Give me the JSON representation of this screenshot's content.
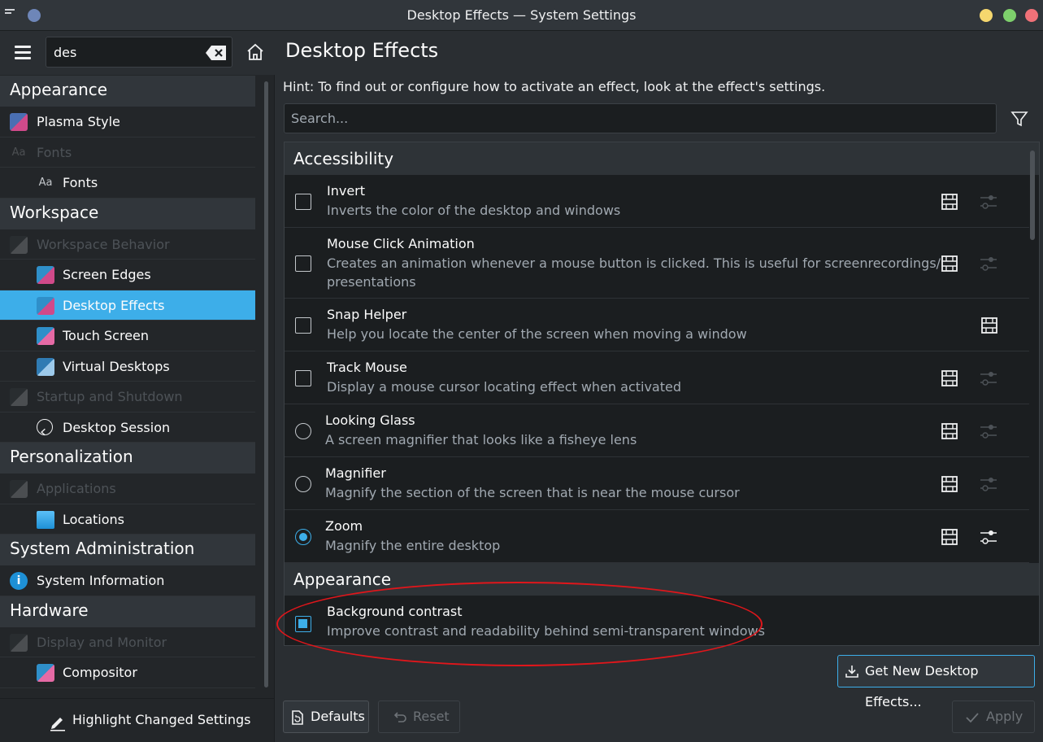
{
  "window": {
    "title": "Desktop Effects — System Settings"
  },
  "sidebar": {
    "search_value": "des",
    "groups": [
      {
        "label": "Appearance",
        "items": [
          {
            "label": "Plasma Style",
            "level": 1,
            "state": "normal"
          },
          {
            "label": "Fonts",
            "level": 1,
            "state": "dim"
          },
          {
            "label": "Fonts",
            "level": 2,
            "state": "normal"
          }
        ]
      },
      {
        "label": "Workspace",
        "items": [
          {
            "label": "Workspace Behavior",
            "level": 1,
            "state": "dim"
          },
          {
            "label": "Screen Edges",
            "level": 2,
            "state": "normal"
          },
          {
            "label": "Desktop Effects",
            "level": 2,
            "state": "selected"
          },
          {
            "label": "Touch Screen",
            "level": 2,
            "state": "normal"
          },
          {
            "label": "Virtual Desktops",
            "level": 2,
            "state": "normal"
          },
          {
            "label": "Startup and Shutdown",
            "level": 1,
            "state": "dim"
          },
          {
            "label": "Desktop Session",
            "level": 2,
            "state": "normal"
          }
        ]
      },
      {
        "label": "Personalization",
        "items": [
          {
            "label": "Applications",
            "level": 1,
            "state": "dim"
          },
          {
            "label": "Locations",
            "level": 2,
            "state": "normal"
          }
        ]
      },
      {
        "label": "System Administration",
        "items": [
          {
            "label": "System Information",
            "level": 1,
            "state": "normal"
          }
        ]
      },
      {
        "label": "Hardware",
        "items": [
          {
            "label": "Display and Monitor",
            "level": 1,
            "state": "dim"
          },
          {
            "label": "Compositor",
            "level": 2,
            "state": "normal"
          }
        ]
      }
    ],
    "highlight_label": "Highlight Changed Settings"
  },
  "main": {
    "title": "Desktop Effects",
    "hint": "Hint: To find out or configure how to activate an effect, look at the effect's settings.",
    "search_placeholder": "Search...",
    "sections": [
      {
        "label": "Accessibility"
      },
      {
        "label": "Appearance"
      }
    ],
    "effects": [
      {
        "name": "Invert",
        "desc": "Inverts the color of the desktop and windows",
        "control": "checkbox",
        "checked": false,
        "configurable": false
      },
      {
        "name": "Mouse Click Animation",
        "desc": "Creates an animation whenever a mouse button is clicked. This is useful for screenrecordings/",
        "desc2": "presentations",
        "control": "checkbox",
        "checked": false,
        "configurable": false
      },
      {
        "name": "Snap Helper",
        "desc": "Help you locate the center of the screen when moving a window",
        "control": "checkbox",
        "checked": false,
        "configurable": null
      },
      {
        "name": "Track Mouse",
        "desc": "Display a mouse cursor locating effect when activated",
        "control": "checkbox",
        "checked": false,
        "configurable": false
      },
      {
        "name": "Looking Glass",
        "desc": "A screen magnifier that looks like a fisheye lens",
        "control": "radio",
        "checked": false,
        "configurable": false
      },
      {
        "name": "Magnifier",
        "desc": "Magnify the section of the screen that is near the mouse cursor",
        "control": "radio",
        "checked": false,
        "configurable": false
      },
      {
        "name": "Zoom",
        "desc": "Magnify the entire desktop",
        "control": "radio",
        "checked": true,
        "configurable": true
      },
      {
        "name": "Background contrast",
        "desc": "Improve contrast and readability behind semi-transparent windows",
        "control": "checkbox",
        "checked": true,
        "configurable": null
      }
    ],
    "buttons": {
      "get_new": "Get New Desktop Effects...",
      "defaults": "Defaults",
      "reset": "Reset",
      "apply": "Apply"
    }
  },
  "colors": {
    "accent": "#3daee9",
    "annotation": "#e0161b"
  }
}
